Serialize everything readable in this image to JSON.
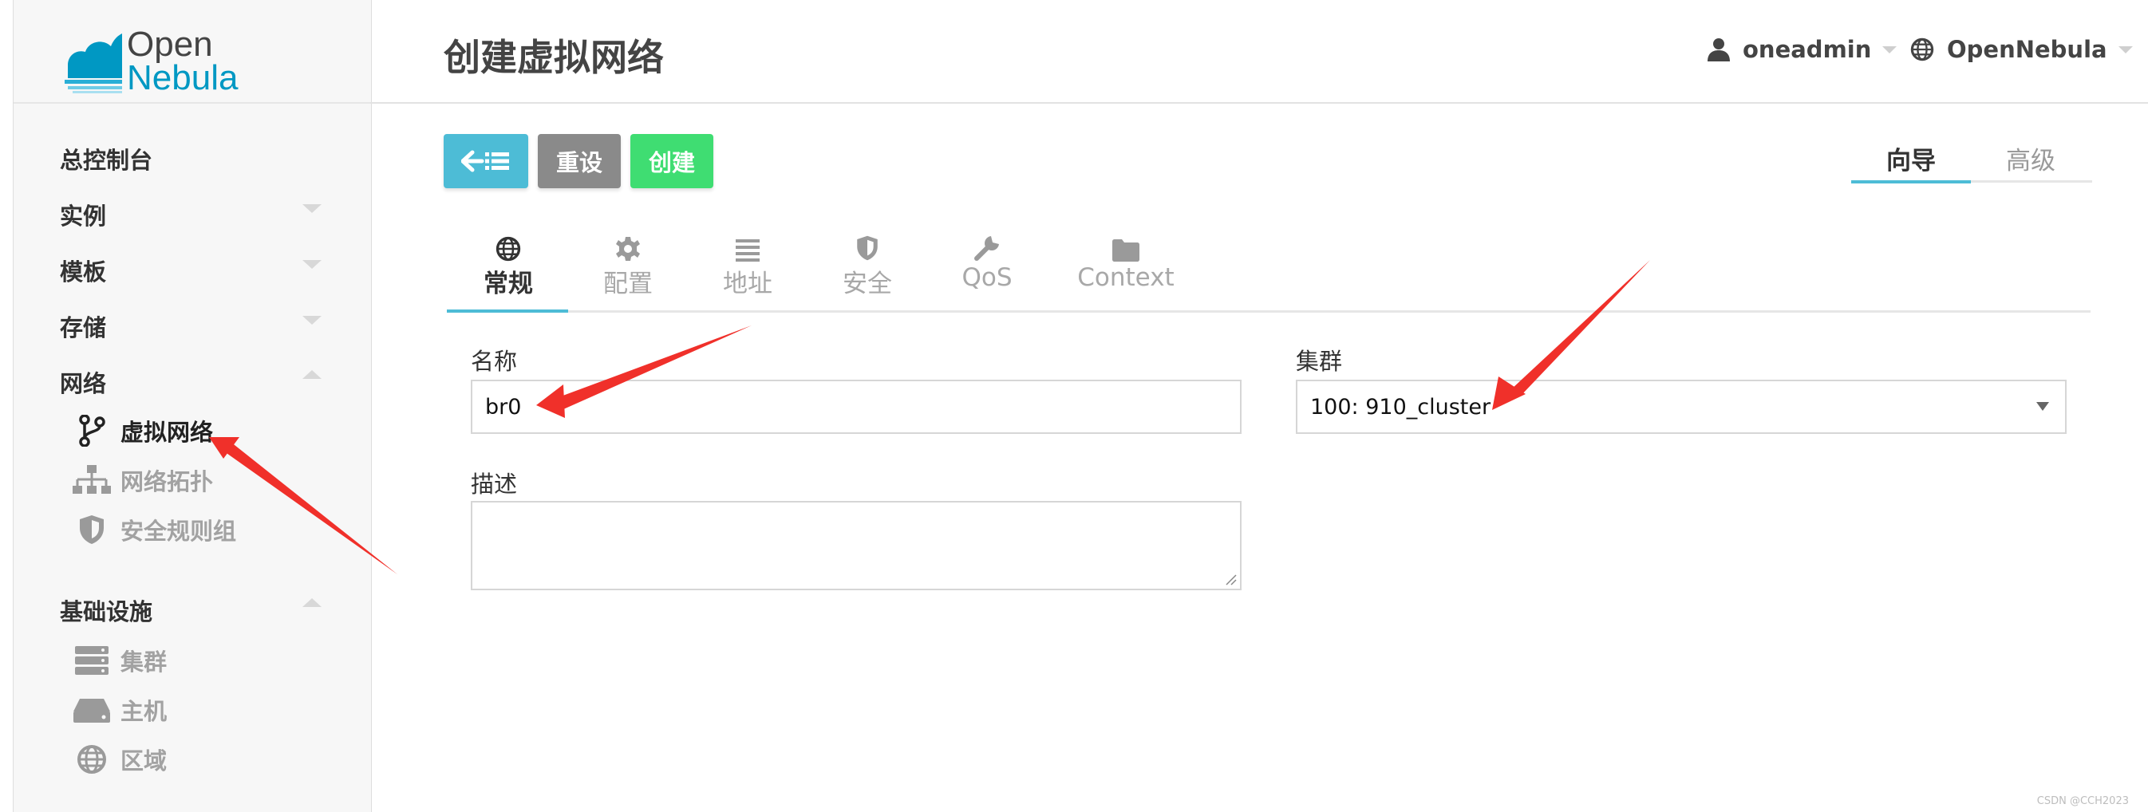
{
  "brand": {
    "line1": "Open",
    "line2": "Nebula"
  },
  "sidebar": {
    "items": [
      {
        "label": "总控制台"
      },
      {
        "label": "实例"
      },
      {
        "label": "模板"
      },
      {
        "label": "存储"
      },
      {
        "label": "网络"
      }
    ],
    "network_sub": [
      {
        "label": "虚拟网络",
        "icon": "network-branch-icon",
        "active": true
      },
      {
        "label": "网络拓扑",
        "icon": "topology-icon"
      },
      {
        "label": "安全规则组",
        "icon": "shield-icon"
      }
    ],
    "infra": {
      "label": "基础设施"
    },
    "infra_sub": [
      {
        "label": "集群",
        "icon": "server-stack-icon"
      },
      {
        "label": "主机",
        "icon": "host-icon"
      },
      {
        "label": "区域",
        "icon": "globe-icon"
      }
    ]
  },
  "header": {
    "title": "创建虚拟网络",
    "user": "oneadmin",
    "zone": "OpenNebula"
  },
  "toolbar": {
    "back_icon": "back-list-icon",
    "reset_label": "重设",
    "create_label": "创建",
    "colors": {
      "back": "#4dbcd6",
      "reset": "#8a8a8a",
      "create": "#3fdd72"
    }
  },
  "mode": {
    "wizard": "向导",
    "advanced": "高级"
  },
  "tabs": [
    {
      "label": "常规",
      "icon": "globe-icon",
      "active": true
    },
    {
      "label": "配置",
      "icon": "gear-icon"
    },
    {
      "label": "地址",
      "icon": "list-icon"
    },
    {
      "label": "安全",
      "icon": "shield-icon"
    },
    {
      "label": "QoS",
      "icon": "wrench-icon"
    },
    {
      "label": "Context",
      "icon": "folder-icon"
    }
  ],
  "form": {
    "name_label": "名称",
    "name_value": "br0",
    "desc_label": "描述",
    "desc_value": "",
    "cluster_label": "集群",
    "cluster_value": "100: 910_cluster"
  },
  "watermark": "CSDN @CCH2023"
}
